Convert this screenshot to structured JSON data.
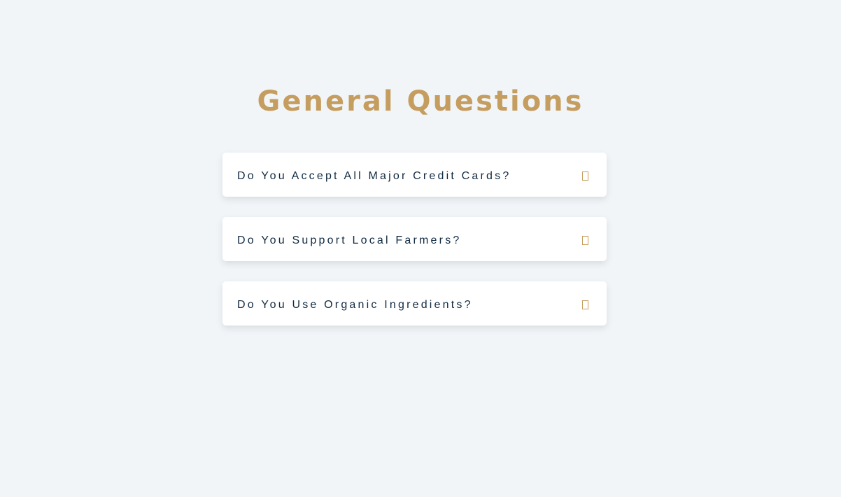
{
  "page": {
    "title": "General Questions"
  },
  "colors": {
    "accent": "#c59d5f",
    "text": "#102a42",
    "background": "#f1f5f8",
    "card": "#ffffff"
  },
  "faq": {
    "items": [
      {
        "question": "Do You Accept All Major Credit Cards?",
        "icon": "plus-icon"
      },
      {
        "question": "Do You Support Local Farmers?",
        "icon": "plus-icon"
      },
      {
        "question": "Do You Use Organic Ingredients?",
        "icon": "plus-icon"
      }
    ]
  }
}
